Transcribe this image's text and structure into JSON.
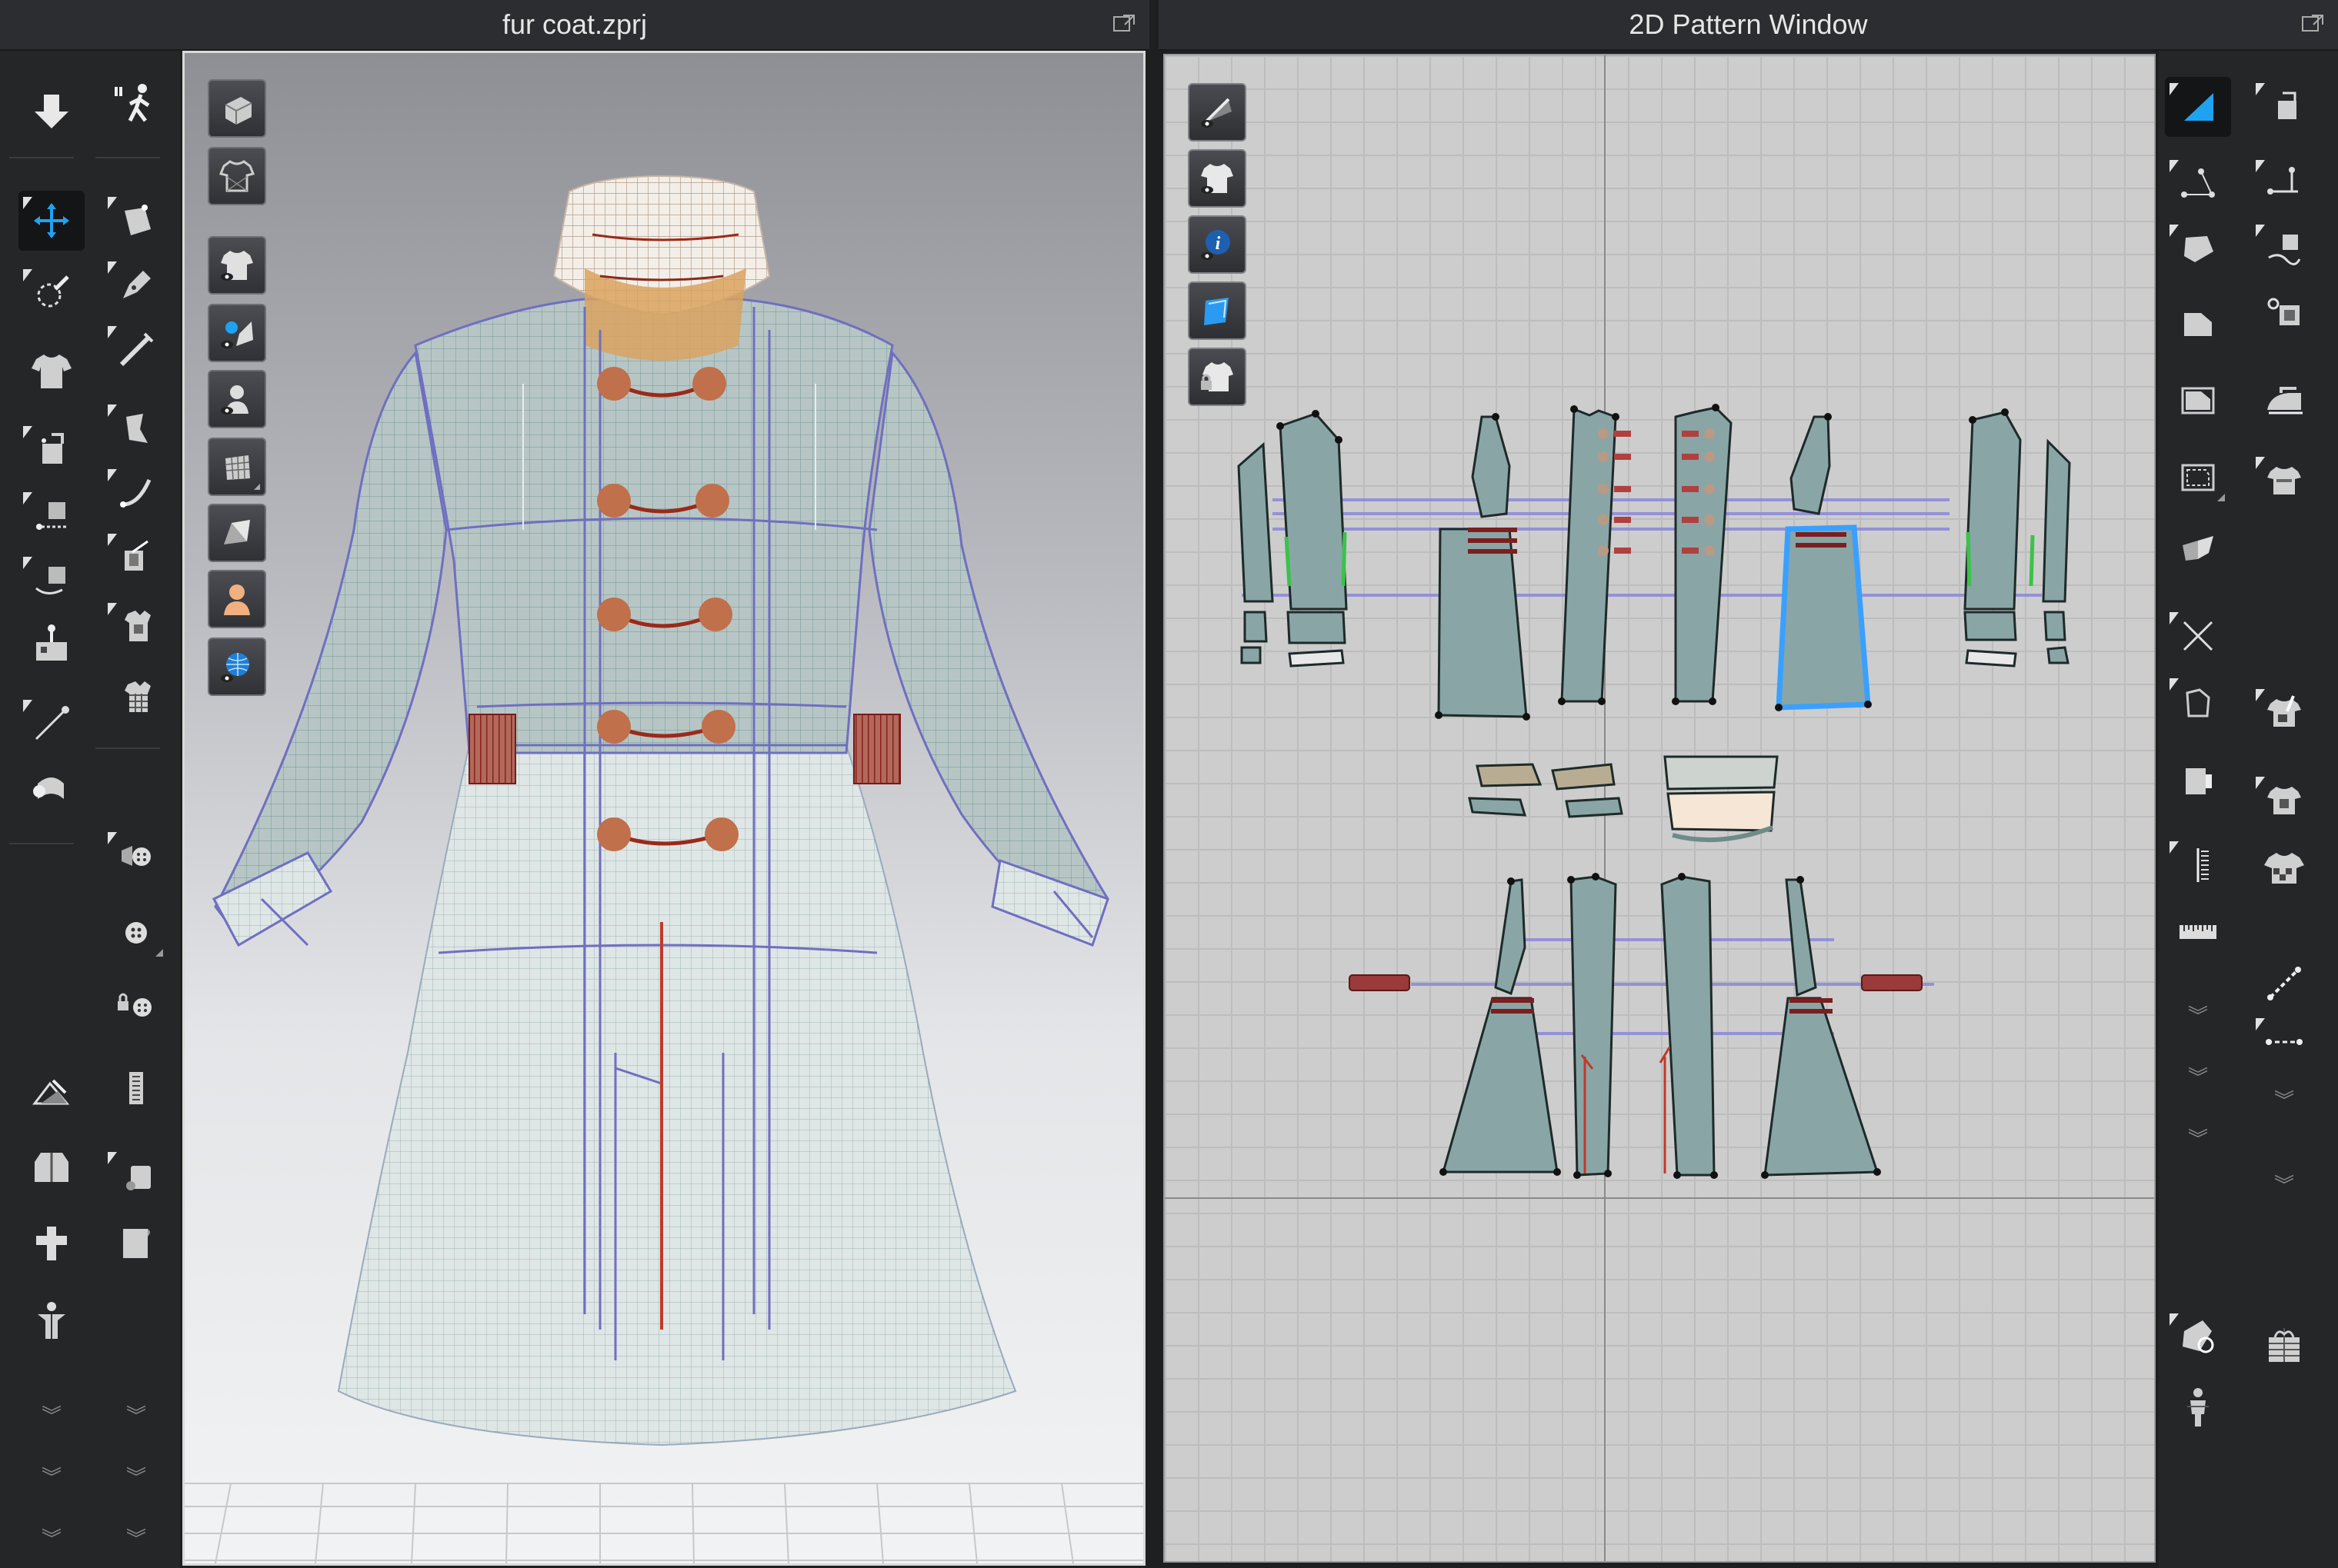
{
  "window_3d": {
    "title": "fur coat.zprj"
  },
  "window_2d": {
    "title": "2D Pattern Window"
  },
  "colors": {
    "accent": "#1fa3f0",
    "pattern_fill": "#8aa5a5",
    "pattern_selected": "#3aa0ff",
    "garment_mesh": "#7f9f9e",
    "button": "#c0704a",
    "elastic": "#a02a2a",
    "background_dark": "#1e1f21"
  },
  "left_toolbar_col1": [
    "arrow-down-icon",
    "move-gizmo-icon",
    "select-mesh-brush-icon",
    "tshirt-icon",
    "fold-arrange-icon",
    "tack-icon",
    "tack-on-avatar-icon",
    "pin-icon",
    "line-pin-icon",
    "fold-icon",
    "edit-render-icon",
    "avatar-jacket-icon",
    "arrange-points-icon",
    "avatar-pose-icon"
  ],
  "left_toolbar_col2": [
    "walk-pose-icon",
    "edit-pattern-icon",
    "pen-icon",
    "edit-curvature-icon",
    "transform-pattern-icon",
    "curve-edit-icon",
    "texture-edit-icon",
    "graphic-icon",
    "topstitch-icon",
    "button-icon",
    "buttonhole-icon",
    "lock-button-icon",
    "zipper-icon",
    "puckering-icon",
    "tape-icon"
  ],
  "viewport_3d_buttons": [
    "show-avatar-icon",
    "show-garment-icon",
    "garment-display-icon",
    "fabric-display-icon",
    "avatar-display-icon",
    "mesh-display-icon",
    "solid-display-icon",
    "skin-display-icon",
    "environment-display-icon"
  ],
  "viewport_2d_buttons": [
    "pattern-display-icon",
    "garment-view-icon",
    "info-display-icon",
    "texture-view-icon",
    "lock-pattern-icon"
  ],
  "right_toolbar_col1": [
    "transform-pattern-icon",
    "edit-pattern-icon",
    "polygon-icon",
    "rectangle-icon",
    "internal-rectangle-icon",
    "dashed-rectangle-icon",
    "symmetry-icon",
    "cross-line-icon",
    "dart-icon",
    "gusset-icon",
    "seam-line-icon",
    "ruler-icon",
    "fabric-settings-icon",
    "avatar-measure-icon"
  ],
  "right_toolbar_col2": [
    "edit-sewing-icon",
    "segment-sewing-icon",
    "free-sewing-icon",
    "trim-sewing-icon",
    "iron-icon",
    "tshirt-arrange-icon",
    "tshirt-pin-icon",
    "tshirt-texture-icon",
    "tshirt-checker-icon",
    "dashed-slash-icon",
    "dashed-line-icon",
    "gift-box-icon"
  ]
}
